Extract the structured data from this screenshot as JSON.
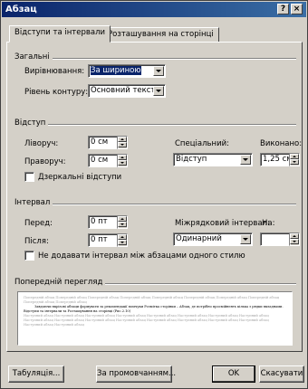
{
  "window": {
    "title": "Абзац",
    "help": "?",
    "close": "×"
  },
  "tabs": [
    {
      "label": "Відступи та інтервали",
      "active": true
    },
    {
      "label": "Розташування на сторінці",
      "active": false
    }
  ],
  "general": {
    "title": "Загальні",
    "alignment_label": "Вирівнювання:",
    "alignment_value": "За шириною",
    "outline_label": "Рівень контуру:",
    "outline_value": "Основний текст"
  },
  "indent": {
    "title": "Відступ",
    "left_label": "Ліворуч:",
    "left_value": "0 см",
    "right_label": "Праворуч:",
    "right_value": "0 см",
    "special_label": "Спеціальний:",
    "special_value": "Відступ",
    "by_label": "Виконано:",
    "by_value": "1,25 см",
    "mirror_label": "Дзеркальні відступи"
  },
  "spacing": {
    "title": "Інтервал",
    "before_label": "Перед:",
    "before_value": "0 пт",
    "after_label": "Після:",
    "after_value": "0 пт",
    "line_label": "Міжрядковий інтервал:",
    "line_value": "Одинарний",
    "at_label": "На:",
    "at_value": "",
    "no_space_label": "Не додавати інтервал між абзацами одного стилю"
  },
  "preview": {
    "title": "Попередній перегляд",
    "prev_text": "Попередній абзац Попередній абзац Попередній абзац Попередній абзац Попередній абзац Попередній абзац Попередній абзац Попередній абзац Попередній абзац Попередній абзац",
    "main_text": "Завдаючи вкрізові абзаци формувати за рекомендації помчуки Розмітка сторінки – Абзац, де потрібно просмійнеять кілька з рядки вкладнами. Відступи та інтервали та Розташування на сторінці (Рис.2.10)",
    "next_text": "Наступний абзац Наступний абзац Наступний абзац Наступний абзац Наступний абзац Наступний абзац Наступний абзац Наступний абзац Наступний абзац Наступний абзац Наступний абзац Наступний абзац Наступний абзац Наступний абзац Наступний абзац Наступний абзац Наступний абзац Наступний абзац"
  },
  "buttons": {
    "tabs": "Табуляція...",
    "default": "За промовчанням...",
    "ok": "OK",
    "cancel": "Скасувати"
  }
}
